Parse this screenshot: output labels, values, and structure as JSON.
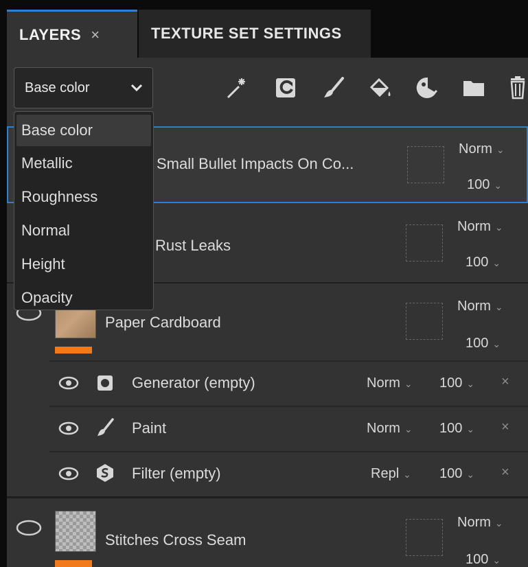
{
  "tabs": {
    "layers_label": "LAYERS",
    "layers_close": "×",
    "texture_set_label": "TEXTURE SET SETTINGS"
  },
  "toolbar": {
    "channel_value": "Base color",
    "tools": [
      "magic-wand-icon",
      "fill-layer-icon",
      "paint-brush-icon",
      "paint-bucket-icon",
      "smart-mask-icon",
      "folder-icon",
      "trash-icon"
    ]
  },
  "channel_menu": {
    "options": [
      "Base color",
      "Metallic",
      "Roughness",
      "Normal",
      "Height",
      "Opacity"
    ]
  },
  "layers": [
    {
      "name": "Small Bullet Impacts On Co...",
      "blend": "Norm",
      "opacity": "100"
    },
    {
      "name": "Rust Leaks",
      "blend": "Norm",
      "opacity": "100"
    },
    {
      "name": "Paper Cardboard",
      "blend": "Norm",
      "opacity": "100",
      "effects": [
        {
          "name": "Generator (empty)",
          "blend": "Norm",
          "opacity": "100",
          "close": "×"
        },
        {
          "name": "Paint",
          "blend": "Norm",
          "opacity": "100",
          "close": "×"
        },
        {
          "name": "Filter (empty)",
          "blend": "Repl",
          "opacity": "100",
          "close": "×"
        }
      ]
    },
    {
      "name": "Stitches Cross Seam",
      "blend": "Norm",
      "opacity": "100"
    }
  ],
  "colors": {
    "accent": "#2f80d0",
    "mask_bar": "#f07a1c",
    "panel": "#333333"
  }
}
